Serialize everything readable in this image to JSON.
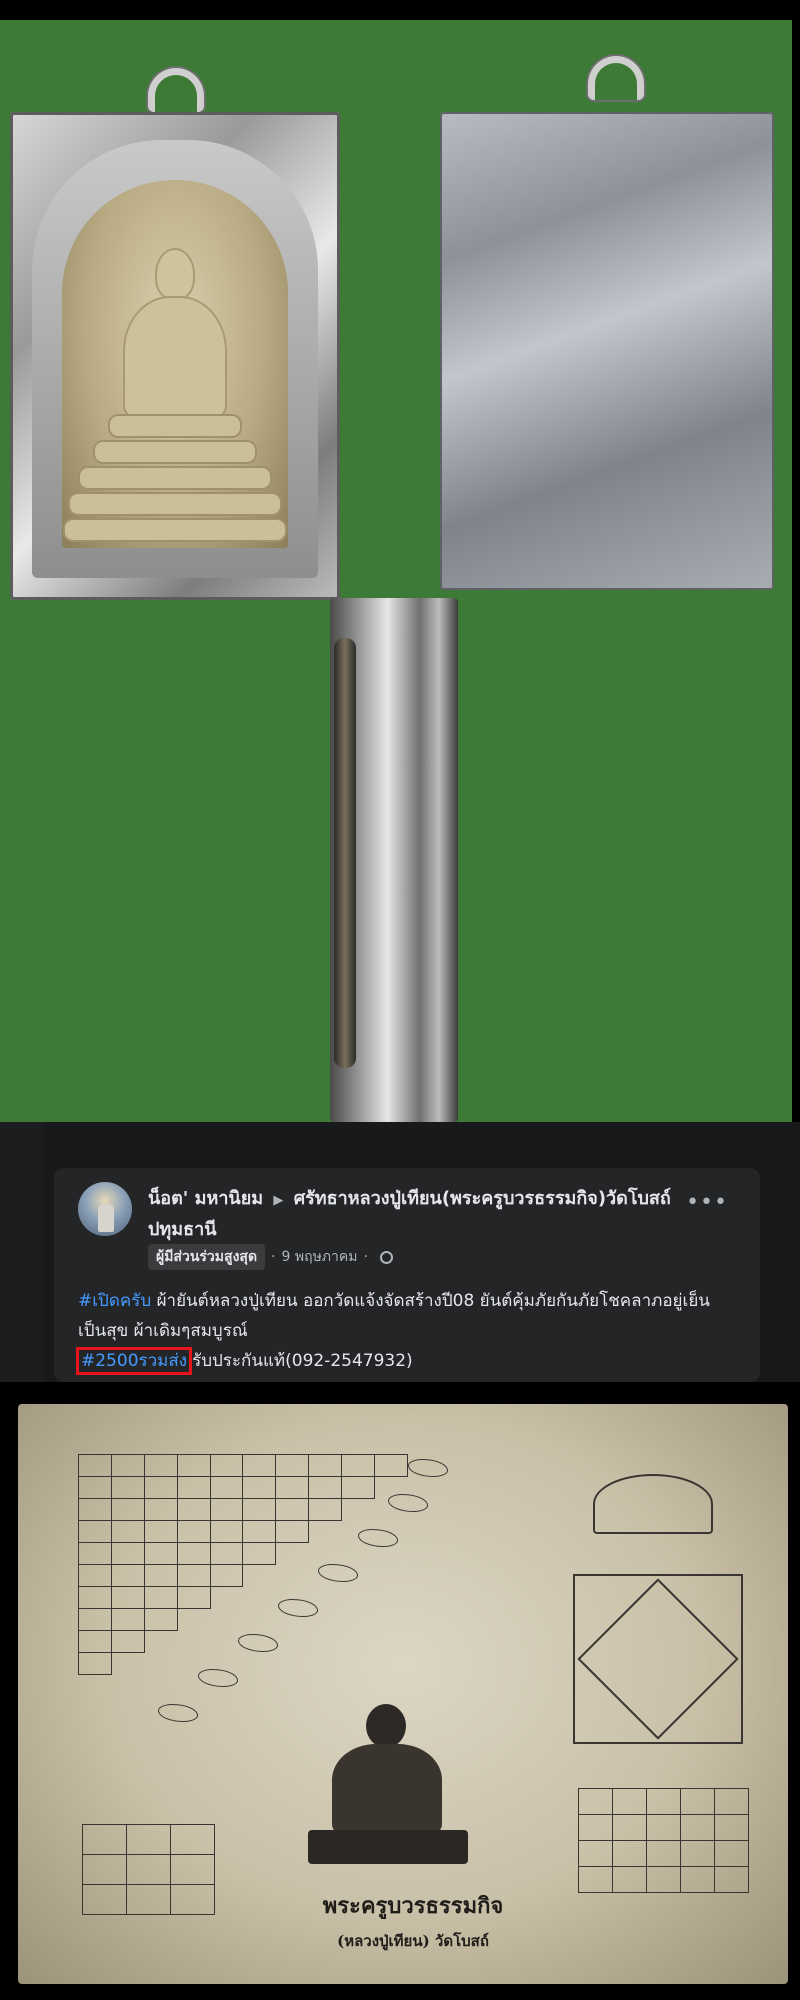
{
  "post": {
    "author": "น็อต' มหานิยม",
    "group": "ศรัทธาหลวงปู่เทียน(พระครูบวรธรรมกิจ)วัดโบสถ์ปทุมธานี",
    "badge": "ผู้มีส่วนร่วมสูงสุด",
    "date": "9 พฤษภาคม",
    "hashtag_open": "#เปิดครับ",
    "body_line1": " ผ้ายันต์หลวงปู่เทียน ออกวัดแจ้งจัดสร้างปี08 ยันต์คุ้มภัยกันภัยโชคลาภอยู่เย็นเป็นสุข ผ้าเดิมๆสมบูรณ์",
    "hashtag_price": "#2500รวมส่ง",
    "body_line2": "รับประกันแท้(092-2547932)",
    "highlight_color": "#e8141b",
    "hashtag_color": "#4599ff"
  },
  "cloth": {
    "caption_line1": "พระครูบวรธรรมกิจ",
    "caption_line2": "(หลวงปู่เทียน) วัดโบสถ์"
  },
  "icons": {
    "more": "more-options-icon",
    "arrow": "group-arrow-icon",
    "globe": "globe-icon"
  }
}
